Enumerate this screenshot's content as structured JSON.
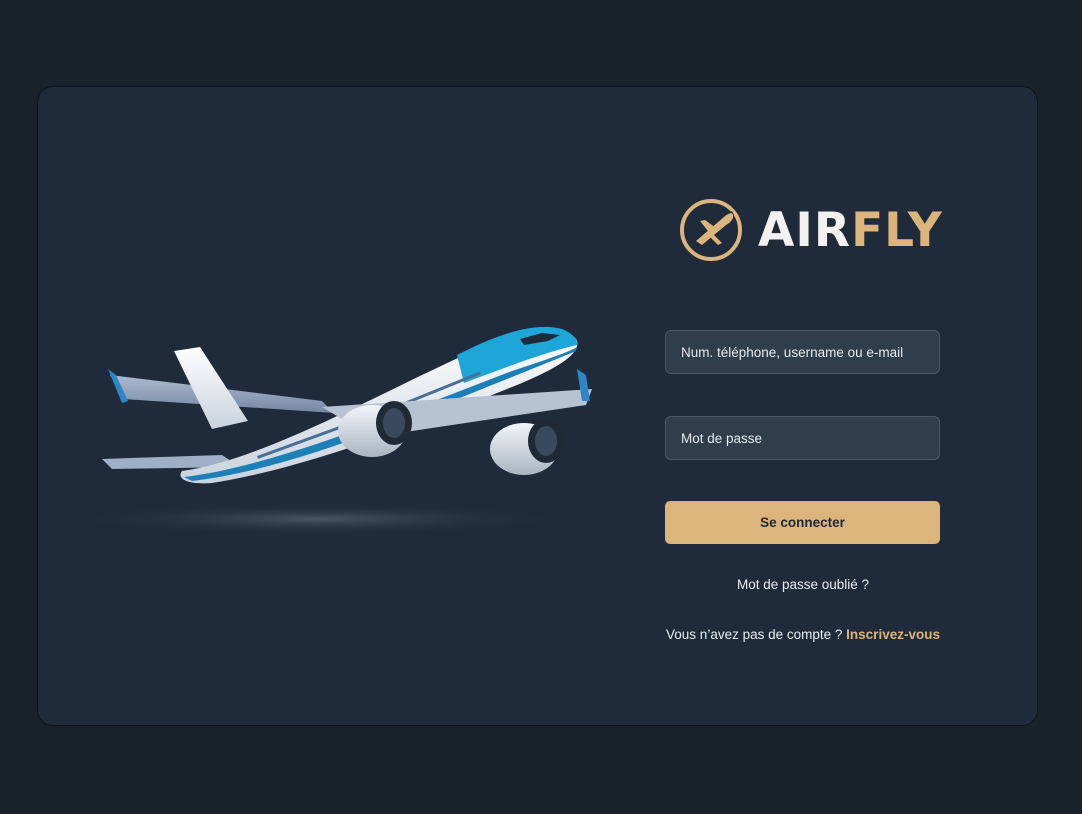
{
  "brand": {
    "name_part1": "AIR",
    "name_part2": "FLY",
    "accent_color": "#dcb57d",
    "logo_icon": "airplane-circle-icon"
  },
  "login_form": {
    "username_placeholder": "Num. téléphone, username ou e-mail",
    "password_placeholder": "Mot de passe",
    "submit_label": "Se connecter",
    "forgot_password_label": "Mot de passe oublié ?",
    "signup_prompt": "Vous n’avez pas de compte ?",
    "signup_link_label": "Inscrivez-vous"
  },
  "colors": {
    "page_background": "#19212b",
    "card_background": "#1f2b3a",
    "input_background": "#303d4b",
    "primary_button": "#dcb57d"
  },
  "illustration": {
    "icon": "airplane-illustration-icon"
  }
}
